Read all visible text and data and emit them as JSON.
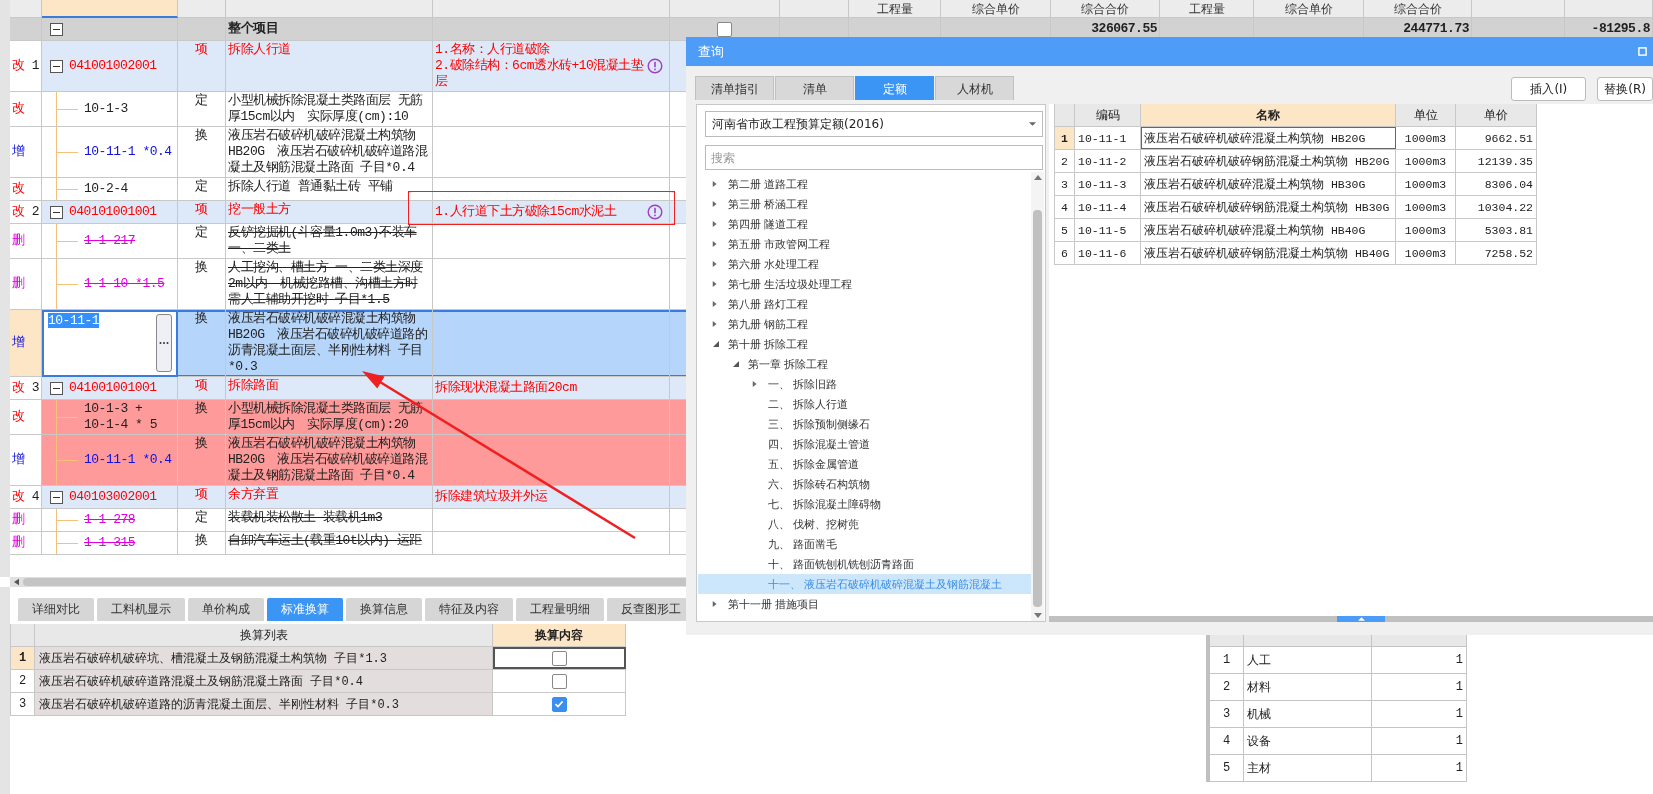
{
  "main_table": {
    "summary_headers": [
      "工程量",
      "综合单价",
      "综合合价",
      "工程量",
      "综合单价",
      "综合合价"
    ],
    "project": {
      "name": "整个项目",
      "expanded": true,
      "checked": false,
      "totals": [
        "326067.55",
        "244771.73",
        "-81295.8"
      ]
    },
    "items": [
      {
        "status": "改",
        "kind": "modified",
        "number": "1",
        "code": "041001002001",
        "expanded": true,
        "unit": "项",
        "name": "拆除人行道",
        "feature": "1.名称：人行道破除\n2.破除结构：6cm透水砖+10混凝土垫层",
        "warning": true,
        "children": [
          {
            "status": "改",
            "kind": "modified",
            "code": "10-1-3",
            "unit": "定",
            "name": "小型机械拆除混凝土类路面层 无筋厚15cm以内　实际厚度(cm):10",
            "selected": false,
            "highlighted": false
          },
          {
            "status": "增",
            "kind": "added",
            "code": "10-11-1 *0.4",
            "unit": "换",
            "name": "液压岩石破碎机破碎混凝土构筑物 HB20G　液压岩石破碎机破碎道路混凝土及钢筋混凝土路面 子目*0.4",
            "selected": false,
            "highlighted": false
          },
          {
            "status": "改",
            "kind": "modified",
            "code": "10-2-4",
            "unit": "定",
            "name": "拆除人行道 普通黏土砖 平铺",
            "selected": false,
            "highlighted": false
          }
        ]
      },
      {
        "status": "改",
        "kind": "modified",
        "number": "2",
        "code": "040101001001",
        "expanded": true,
        "unit": "项",
        "name": "挖一般土方",
        "feature": "1.人行道下土方破除15cm水泥土",
        "warning": true,
        "children": [
          {
            "status": "删",
            "kind": "deleted",
            "code": "1-1-217",
            "unit": "定",
            "name": "反铲挖掘机(斗容量1.0m3)不装车一、二类土",
            "selected": false,
            "highlighted": false
          },
          {
            "status": "删",
            "kind": "deleted",
            "code": "1-1-10 *1.5",
            "unit": "换",
            "name": "人工挖沟、槽土方 一、二类土深度2m以内　机械挖路槽、沟槽土方时需人工辅助开挖时 子目*1.5",
            "selected": false,
            "highlighted": false
          },
          {
            "status": "增",
            "kind": "added",
            "code": "10-11-1",
            "unit": "换",
            "name": "液压岩石破碎机破碎混凝土构筑物 HB20G　液压岩石破碎机破碎道路的沥青混凝土面层、半刚性材料 子目*0.3",
            "selected": true,
            "highlighted": false
          }
        ]
      },
      {
        "status": "改",
        "kind": "modified",
        "number": "3",
        "code": "041001001001",
        "expanded": true,
        "unit": "项",
        "name": "拆除路面",
        "feature": "拆除现状混凝土路面20cm",
        "warning": false,
        "children": [
          {
            "status": "改",
            "kind": "modified",
            "code": "10-1-3 +\n10-1-4 * 5",
            "unit": "换",
            "name": "小型机械拆除混凝土类路面层 无筋厚15cm以内　实际厚度(cm):20",
            "selected": false,
            "highlighted": true
          },
          {
            "status": "增",
            "kind": "added",
            "code": "10-11-1 *0.4",
            "unit": "换",
            "name": "液压岩石破碎机破碎混凝土构筑物 HB20G　液压岩石破碎机破碎道路混凝土及钢筋混凝土路面 子目*0.4",
            "selected": false,
            "highlighted": true
          }
        ]
      },
      {
        "status": "改",
        "kind": "modified",
        "number": "4",
        "code": "040103002001",
        "expanded": true,
        "unit": "项",
        "name": "余方弃置",
        "feature": "拆除建筑垃圾并外运",
        "warning": false,
        "children": [
          {
            "status": "删",
            "kind": "deleted",
            "code": "1-1-278",
            "unit": "定",
            "name": "装载机装松散土 装载机1m3",
            "selected": false,
            "highlighted": false
          },
          {
            "status": "删",
            "kind": "deleted",
            "code": "1-1-315",
            "unit": "换",
            "name": "自卸汽车运土(载重10t以内) 运距",
            "selected": false,
            "highlighted": false
          }
        ]
      }
    ]
  },
  "bottom_tabs": [
    {
      "label": "详细对比",
      "selected": false
    },
    {
      "label": "工料机显示",
      "selected": false
    },
    {
      "label": "单价构成",
      "selected": false
    },
    {
      "label": "标准换算",
      "selected": true
    },
    {
      "label": "换算信息",
      "selected": false
    },
    {
      "label": "特征及内容",
      "selected": false
    },
    {
      "label": "工程量明细",
      "selected": false
    },
    {
      "label": "反查图形工",
      "selected": false
    }
  ],
  "conversion_table": {
    "columns": [
      "换算列表",
      "换算内容"
    ],
    "rows": [
      {
        "number": "1",
        "text": "液压岩石破碎机破碎坑、槽混凝土及钢筋混凝土构筑物 子目*1.3",
        "checked": false,
        "selected": true
      },
      {
        "number": "2",
        "text": "液压岩石破碎机破碎道路混凝土及钢筋混凝土路面 子目*0.4",
        "checked": false,
        "selected": false
      },
      {
        "number": "3",
        "text": "液压岩石破碎机破碎道路的沥青混凝土面层、半刚性材料 子目*0.3",
        "checked": true,
        "selected": false
      }
    ]
  },
  "factor_table": {
    "rows": [
      {
        "number": "1",
        "category": "人工",
        "factor": "1"
      },
      {
        "number": "2",
        "category": "材料",
        "factor": "1"
      },
      {
        "number": "3",
        "category": "机械",
        "factor": "1"
      },
      {
        "number": "4",
        "category": "设备",
        "factor": "1"
      },
      {
        "number": "5",
        "category": "主材",
        "factor": "1"
      }
    ]
  },
  "query_dialog": {
    "title": "查询",
    "tabs": [
      {
        "label": "清单指引",
        "selected": false
      },
      {
        "label": "清单",
        "selected": false
      },
      {
        "label": "定额",
        "selected": true
      },
      {
        "label": "人材机",
        "selected": false
      }
    ],
    "buttons": [
      "插入(I)",
      "替换(R)"
    ],
    "library": "河南省市政工程预算定额(2016)",
    "search": {
      "placeholder": "搜索"
    },
    "tree": [
      {
        "label": "第二册 道路工程",
        "kind": "group",
        "expanded": false,
        "selected": false
      },
      {
        "label": "第三册 桥涵工程",
        "kind": "group",
        "expanded": false,
        "selected": false
      },
      {
        "label": "第四册 隧道工程",
        "kind": "group",
        "expanded": false,
        "selected": false
      },
      {
        "label": "第五册 市政管网工程",
        "kind": "group",
        "expanded": false,
        "selected": false
      },
      {
        "label": "第六册 水处理工程",
        "kind": "group",
        "expanded": false,
        "selected": false
      },
      {
        "label": "第七册 生活垃圾处理工程",
        "kind": "group",
        "expanded": false,
        "selected": false
      },
      {
        "label": "第八册 路灯工程",
        "kind": "group",
        "expanded": false,
        "selected": false
      },
      {
        "label": "第九册 钢筋工程",
        "kind": "group",
        "expanded": false,
        "selected": false
      },
      {
        "label": "第十册 拆除工程",
        "kind": "group",
        "expanded": true,
        "selected": false,
        "children": [
          {
            "label": "第一章 拆除工程",
            "kind": "group",
            "expanded": true,
            "selected": false,
            "children": [
              {
                "label": "一、 拆除旧路",
                "kind": "group",
                "expanded": false,
                "selected": false
              },
              {
                "label": "二、 拆除人行道",
                "kind": "leaf",
                "selected": false
              },
              {
                "label": "三、 拆除预制侧缘石",
                "kind": "leaf",
                "selected": false
              },
              {
                "label": "四、 拆除混凝土管道",
                "kind": "leaf",
                "selected": false
              },
              {
                "label": "五、 拆除金属管道",
                "kind": "leaf",
                "selected": false
              },
              {
                "label": "六、 拆除砖石构筑物",
                "kind": "leaf",
                "selected": false
              },
              {
                "label": "七、 拆除混凝土障碍物",
                "kind": "leaf",
                "selected": false
              },
              {
                "label": "八、 伐树、挖树蔸",
                "kind": "leaf",
                "selected": false
              },
              {
                "label": "九、 路面凿毛",
                "kind": "leaf",
                "selected": false
              },
              {
                "label": "十、 路面铣刨机铣刨沥青路面",
                "kind": "leaf",
                "selected": false
              },
              {
                "label": "十一、 液压岩石破碎机破碎混凝土及钢筋混凝土",
                "kind": "leaf",
                "selected": true
              }
            ]
          }
        ]
      },
      {
        "label": "第十一册 措施项目",
        "kind": "group",
        "expanded": false,
        "selected": false
      }
    ],
    "results": {
      "columns": [
        "编码",
        "名称",
        "单位",
        "单价"
      ],
      "rows": [
        {
          "number": "1",
          "code": "10-11-1",
          "name": "液压岩石破碎机破碎混凝土构筑物 HB20G",
          "unit": "1000m3",
          "price": "9662.51",
          "selected": true
        },
        {
          "number": "2",
          "code": "10-11-2",
          "name": "液压岩石破碎机破碎钢筋混凝土构筑物 HB20G",
          "unit": "1000m3",
          "price": "12139.35",
          "selected": false
        },
        {
          "number": "3",
          "code": "10-11-3",
          "name": "液压岩石破碎机破碎混凝土构筑物 HB30G",
          "unit": "1000m3",
          "price": "8306.04",
          "selected": false
        },
        {
          "number": "4",
          "code": "10-11-4",
          "name": "液压岩石破碎机破碎钢筋混凝土构筑物 HB30G",
          "unit": "1000m3",
          "price": "10304.22",
          "selected": false
        },
        {
          "number": "5",
          "code": "10-11-5",
          "name": "液压岩石破碎机破碎混凝土构筑物 HB40G",
          "unit": "1000m3",
          "price": "5303.81",
          "selected": false
        },
        {
          "number": "6",
          "code": "10-11-6",
          "name": "液压岩石破碎机破碎钢筋混凝土构筑物 HB40G",
          "unit": "1000m3",
          "price": "7258.52",
          "selected": false
        }
      ]
    }
  }
}
